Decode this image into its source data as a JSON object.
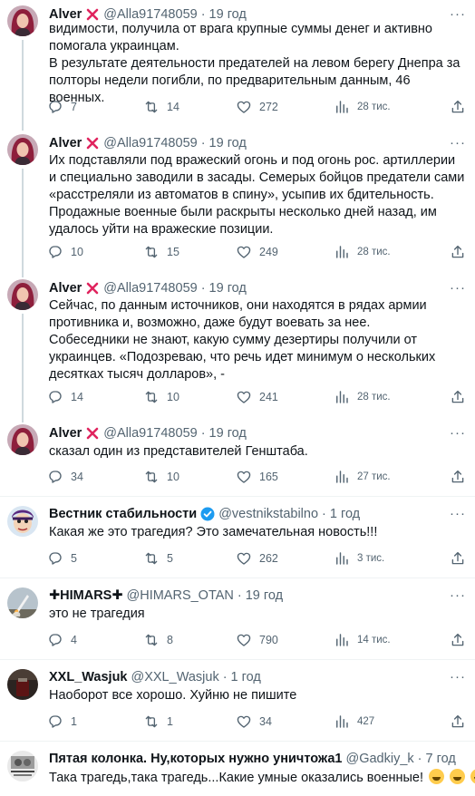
{
  "tweets": [
    {
      "author": "Alver",
      "handle": "@Alla91748059",
      "dot": "·",
      "time": "19 год",
      "text": "видимости, получила от врага крупные суммы денег и активно помогала украинцам.\nВ результате деятельности предателей на левом берегу Днепра за полторы недели погибли, по предварительным данным, 46 военных.",
      "replies": "7",
      "retweets": "14",
      "likes": "272",
      "views": "28 тис."
    },
    {
      "author": "Alver",
      "handle": "@Alla91748059",
      "dot": "·",
      "time": "19 год",
      "text": "Их подставляли под вражеский огонь и под огонь рос. артиллерии и специально заводили в засады. Семерых бойцов предатели сами «расстреляли из автоматов в спину», усыпив их бдительность.\nПродажные военные были раскрыты несколько дней назад,  им удалось уйти на вражеские позиции.",
      "replies": "10",
      "retweets": "15",
      "likes": "249",
      "views": "28 тис."
    },
    {
      "author": "Alver",
      "handle": "@Alla91748059",
      "dot": "·",
      "time": "19 год",
      "text": "Сейчас, по данным источников, они находятся в рядах армии противника и, возможно, даже будут воевать за нее.\nСобеседники не знают, какую сумму дезертиры получили от украинцев. «Подозреваю, что речь идет минимум о нескольких десятках тысяч долларов», -",
      "replies": "14",
      "retweets": "10",
      "likes": "241",
      "views": "28 тис."
    },
    {
      "author": "Alver",
      "handle": "@Alla91748059",
      "dot": "·",
      "time": "19 год",
      "text": "сказал один из представителей Генштаба.",
      "replies": "34",
      "retweets": "10",
      "likes": "165",
      "views": "27 тис."
    },
    {
      "author": "Вестник стабильности",
      "handle": "@vestnikstabilno",
      "dot": "·",
      "time": "1 год",
      "text": "Какая же это трагедия? Это замечательная новость!!!",
      "replies": "5",
      "retweets": "5",
      "likes": "262",
      "views": "3 тис."
    },
    {
      "author": "✚HIMARS✚",
      "handle": "@HIMARS_OTAN",
      "dot": "·",
      "time": "19 год",
      "text": "это не трагедия",
      "replies": "4",
      "retweets": "8",
      "likes": "790",
      "views": "14 тис."
    },
    {
      "author": "XXL_Wasjuk",
      "handle": "@XXL_Wasjuk",
      "dot": "·",
      "time": "1 год",
      "text": "Наоборот все хорошо. Хуйню не пишите",
      "replies": "1",
      "retweets": "1",
      "likes": "34",
      "views": "427"
    },
    {
      "author": "Пятая колонка. Ну,которых нужно уничтожа1",
      "handle": "@Gadkiy_k",
      "dot": "·",
      "time": "7 год",
      "text": "Така трагедь,така трагедь...Какие умные оказались военные!"
    }
  ],
  "avatars": {
    "alver": "woman-red-hair-avatar",
    "vestnik": "cartoon-face-avatar",
    "himars": "rocket-launch-avatar",
    "xxl": "dark-photo-avatar",
    "pyataya": "meme-avatar"
  },
  "colors": {
    "text": "#0f1419",
    "muted": "#536471",
    "verified": "#1d9bf0",
    "cross": "#e0245e",
    "separator": "#eff3f4"
  }
}
